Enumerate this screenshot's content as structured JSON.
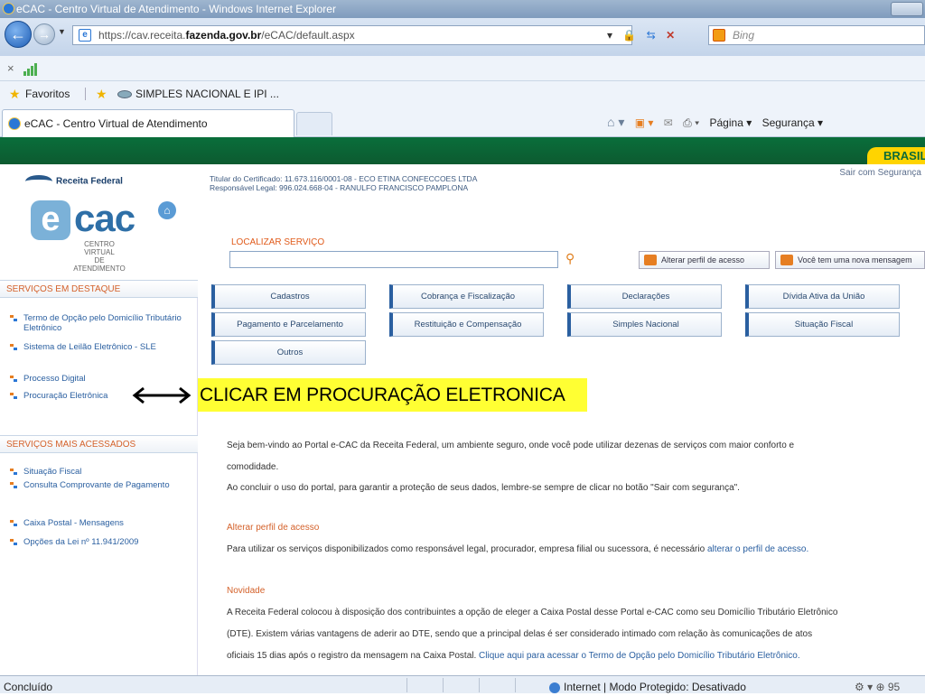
{
  "window": {
    "title": "eCAC - Centro Virtual de Atendimento - Windows Internet Explorer"
  },
  "address": {
    "url_prefix": "https://cav.receita.",
    "url_domain": "fazenda.gov.br",
    "url_path": "/eCAC/default.aspx",
    "search_placeholder": "Bing"
  },
  "favorites": {
    "label": "Favoritos",
    "item": "SIMPLES NACIONAL E IPI ..."
  },
  "tab": {
    "title": "eCAC - Centro Virtual de Atendimento"
  },
  "commands": {
    "page": "Página ▾",
    "security": "Segurança ▾"
  },
  "site": {
    "brasil": "BRASIL",
    "logout": "Sair com Segurança",
    "rf_logo": "Receita Federal",
    "ecac_text": "cac",
    "ecac_sub_1": "CENTRO VIRTUAL",
    "ecac_sub_2": "DE ATENDIMENTO",
    "cert_line1": "Titular do Certificado: 11.673.116/0001-08 - ECO ETINA CONFECCOES LTDA",
    "cert_line2": "Responsável Legal: 996.024.668-04 - RANULFO FRANCISCO PAMPLONA",
    "locate_label": "LOCALIZAR SERVIÇO",
    "alter_profile": "Alterar perfil de acesso",
    "new_message": "Você tem uma nova mensagem"
  },
  "sidebar": {
    "featured_title": "SERVIÇOS EM DESTAQUE",
    "featured": [
      "Termo de Opção pelo Domicílio Tributário Eletrônico",
      "Sistema de Leilão Eletrônico - SLE",
      "Processo Digital",
      "Procuração Eletrônica"
    ],
    "accessed_title": "SERVIÇOS MAIS ACESSADOS",
    "accessed": [
      "Situação Fiscal",
      "Consulta Comprovante de Pagamento",
      "Caixa Postal - Mensagens",
      "Opções da Lei nº 11.941/2009"
    ]
  },
  "services": [
    "Cadastros",
    "Cobrança e Fiscalização",
    "Declarações",
    "Dívida Ativa da União",
    "Pagamento e Parcelamento",
    "Restituição e Compensação",
    "Simples Nacional",
    "Situação Fiscal",
    "Outros"
  ],
  "annotation": {
    "text": "CLICAR EM PROCURAÇÃO ELETRONICA"
  },
  "content": {
    "welcome_1": "Seja bem-vindo ao Portal e-CAC da Receita Federal, um ambiente seguro, onde você pode utilizar dezenas de serviços com maior conforto e",
    "welcome_2": "comodidade.",
    "welcome_3": "Ao concluir o uso do portal, para garantir a proteção de seus dados, lembre-se sempre de clicar no botão \"Sair com segurança\".",
    "alter_title": "Alterar perfil de acesso",
    "alter_text": "Para utilizar os serviços disponibilizados como responsável legal, procurador, empresa filial ou sucessora, é necessário ",
    "alter_link": "alterar o perfil de acesso.",
    "news_title": "Novidade",
    "news_1": "A Receita Federal colocou à disposição dos contribuintes a opção de eleger a Caixa Postal desse Portal e-CAC como seu Domicílio Tributário Eletrônico",
    "news_2": "(DTE). Existem várias vantagens de aderir ao DTE, sendo que a principal delas é ser considerado intimado com relação às comunicações de atos",
    "news_3": "oficiais 15 dias após o registro da mensagem na Caixa Postal. ",
    "news_link": "Clique aqui para acessar o Termo de Opção pelo Domicílio Tributário Eletrônico."
  },
  "status": {
    "left": "Concluído",
    "zone": "Internet | Modo Protegido: Desativado",
    "zoom": "⚙ ▾  ⊕ 95"
  }
}
